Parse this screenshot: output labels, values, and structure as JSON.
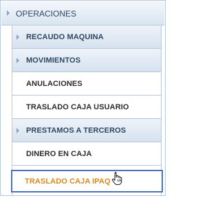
{
  "menu": {
    "root_label": "OPERACIONES",
    "items": [
      {
        "label": "RECAUDO MAQUINA",
        "type": "group"
      },
      {
        "label": "MOVIMIENTOS",
        "type": "group"
      },
      {
        "label": "ANULACIONES",
        "type": "leaf"
      },
      {
        "label": "TRASLADO CAJA USUARIO",
        "type": "leaf"
      },
      {
        "label": "PRESTAMOS A TERCEROS",
        "type": "group"
      },
      {
        "label": "DINERO EN CAJA",
        "type": "leaf"
      },
      {
        "label": "TRASLADO CAJA IPAQ",
        "type": "leaf",
        "selected": true
      }
    ]
  },
  "colors": {
    "border": "#b7c8da",
    "group_text": "#2d4763",
    "selected_text": "#d98a1e",
    "selected_border": "#4a72b8"
  },
  "icons": {
    "expand_arrow": "chevron-right-icon",
    "cursor": "hand-pointer-icon"
  }
}
